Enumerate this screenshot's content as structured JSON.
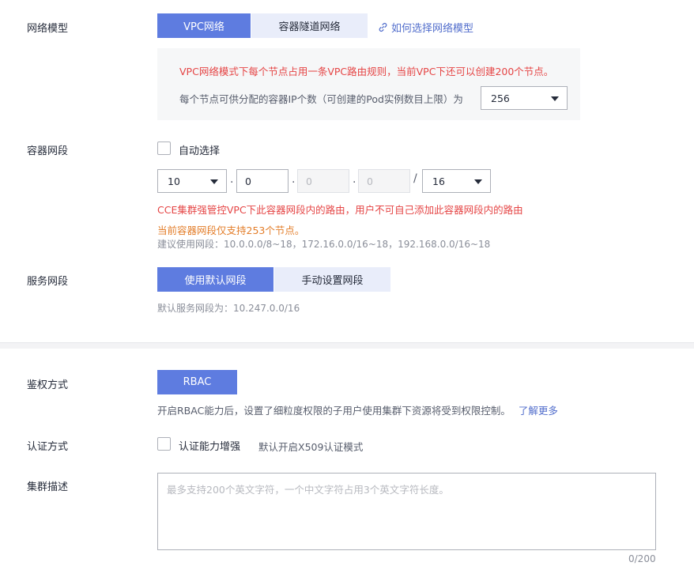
{
  "network_model": {
    "label": "网络模型",
    "options": [
      "VPC网络",
      "容器隧道网络"
    ],
    "selected": "VPC网络",
    "help_link": "如何选择网络模型",
    "info": {
      "warning": "VPC网络模式下每个节点占用一条VPC路由规则，当前VPC下还可以创建200个节点。",
      "ip_label": "每个节点可供分配的容器IP个数（可创建的Pod实例数目上限）为",
      "ip_value": "256"
    }
  },
  "container_cidr": {
    "label": "容器网段",
    "auto_select_label": "自动选择",
    "auto_select_checked": false,
    "octet1": "10",
    "octet2": "0",
    "octet3": "0",
    "octet4": "0",
    "separator_dot": ".",
    "separator_slash": "/",
    "mask": "16",
    "warning": "CCE集群强管控VPC下此容器网段内的路由，用户不可自己添加此容器网段内的路由",
    "notice": "当前容器网段仅支持253个节点。",
    "suggestion": "建议使用网段：10.0.0.0/8~18，172.16.0.0/16~18，192.168.0.0/16~18"
  },
  "service_cidr": {
    "label": "服务网段",
    "options": [
      "使用默认网段",
      "手动设置网段"
    ],
    "selected": "使用默认网段",
    "default_text": "默认服务网段为：10.247.0.0/16"
  },
  "auth_mode": {
    "label": "鉴权方式",
    "button": "RBAC",
    "description": "开启RBAC能力后，设置了细粒度权限的子用户使用集群下资源将受到权限控制。",
    "learn_more": "了解更多"
  },
  "authentication": {
    "label": "认证方式",
    "checkbox_label": "认证能力增强",
    "checked": false,
    "hint": "默认开启X509认证模式"
  },
  "description": {
    "label": "集群描述",
    "placeholder": "最多支持200个英文字符，一个中文字符占用3个英文字符长度。",
    "value": "",
    "counter": "0/200"
  },
  "colors": {
    "accent": "#5e7ce0",
    "accent_light": "#e9edfa",
    "warning_red": "#e54545",
    "notice_orange": "#e37d29",
    "link": "#526ecc"
  }
}
